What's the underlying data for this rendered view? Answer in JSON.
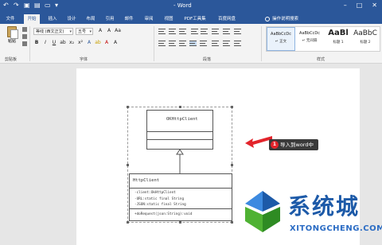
{
  "app": {
    "title": "- Word"
  },
  "qat": {
    "icons": [
      "undo-icon",
      "redo-icon",
      "save-icon",
      "open-icon",
      "folder-icon",
      "dropdown-icon"
    ]
  },
  "tabs": [
    {
      "label": "文件"
    },
    {
      "label": "开始"
    },
    {
      "label": "插入"
    },
    {
      "label": "设计"
    },
    {
      "label": "布局"
    },
    {
      "label": "引用"
    },
    {
      "label": "邮件"
    },
    {
      "label": "审阅"
    },
    {
      "label": "视图"
    },
    {
      "label": "PDF工具集"
    },
    {
      "label": "百度网盘"
    }
  ],
  "tellme": {
    "label": "操作说明搜索"
  },
  "ribbon": {
    "clipboard": {
      "paste_label": "粘贴",
      "group_label": "剪贴板"
    },
    "font": {
      "font_name": "等线 (西文正文)",
      "font_size": "五号",
      "group_label": "字体"
    },
    "paragraph": {
      "group_label": "段落"
    },
    "styles": {
      "group_label": "样式",
      "items": [
        {
          "sample": "AaBbCcDc",
          "name": "↵ 正文"
        },
        {
          "sample": "AaBbCcDc",
          "name": "↵ 无间隔"
        },
        {
          "sample": "AaBl",
          "name": "标题 1"
        },
        {
          "sample": "AaBbC",
          "name": "标题 2"
        }
      ]
    }
  },
  "diagram": {
    "class1": {
      "name": "OKHttpClient"
    },
    "class2": {
      "name": "HttpClient",
      "attributes": [
        "-client:OkHttpClient",
        "-URL:static final String",
        "-JSON:static final String",
        "+doRequest(json:String):void"
      ]
    }
  },
  "callout": {
    "number": "1",
    "text": "导入到word中"
  },
  "watermark": {
    "cn": "系统城",
    "en": "XITONGCHENG.COM"
  },
  "colors": {
    "word_blue": "#2b579a",
    "callout_red": "#e3242b",
    "logo_blue": "#1d5aa8"
  }
}
